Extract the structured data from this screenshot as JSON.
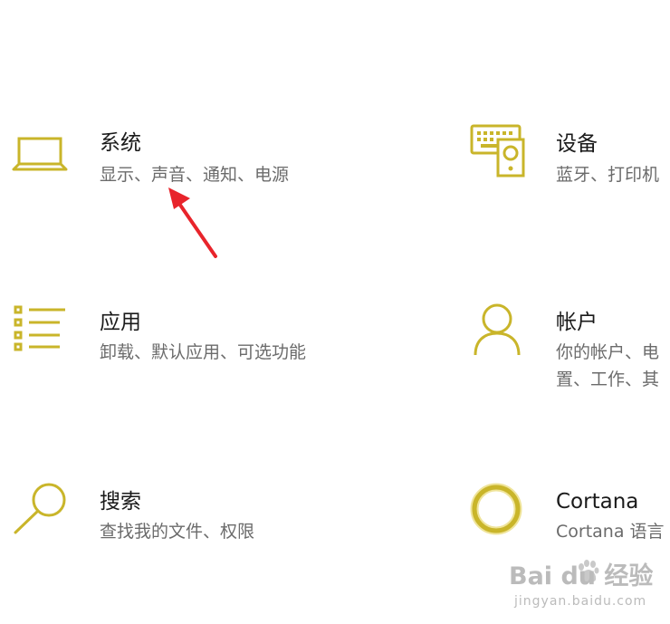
{
  "accent_color": "#c9b52a",
  "tiles": [
    {
      "title": "系统",
      "desc": [
        "显示、声音、通知、电源"
      ],
      "icon": "laptop-icon"
    },
    {
      "title": "设备",
      "desc": [
        "蓝牙、打印机"
      ],
      "icon": "devices-icon"
    },
    {
      "title": "应用",
      "desc": [
        "卸载、默认应用、可选功能"
      ],
      "icon": "apps-list-icon"
    },
    {
      "title": "帐户",
      "desc": [
        "你的帐户、电",
        "置、工作、其"
      ],
      "icon": "person-icon"
    },
    {
      "title": "搜索",
      "desc": [
        "查找我的文件、权限"
      ],
      "icon": "search-icon"
    },
    {
      "title": "Cortana",
      "desc": [
        "Cortana 语言"
      ],
      "icon": "cortana-icon"
    }
  ],
  "annotation": {
    "arrow_color": "#e8242b",
    "icon": "red-arrow-icon"
  },
  "watermark": {
    "main": "Bai du 经验",
    "sub": "jingyan.baidu.com"
  }
}
